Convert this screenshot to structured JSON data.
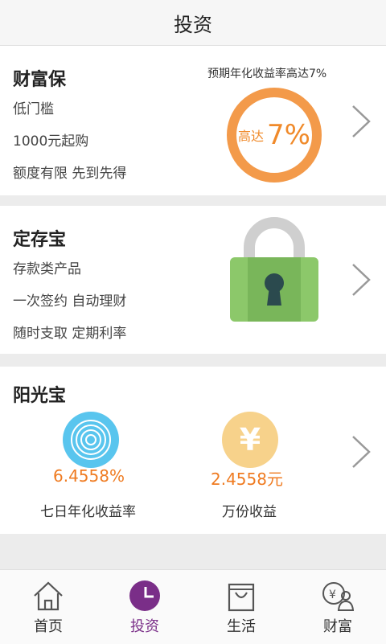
{
  "header": {
    "title": "投资"
  },
  "card1": {
    "name": "财富保",
    "lines": [
      "低门槛",
      "1000元起购",
      "额度有限 先到先得"
    ],
    "expected": "预期年化收益率高达7%",
    "ring_prefix": "高达",
    "ring_value": "7%"
  },
  "card2": {
    "name": "定存宝",
    "lines": [
      "存款类产品",
      "一次签约 自动理财",
      "随时支取 定期利率"
    ]
  },
  "card3": {
    "name": "阳光宝",
    "rate_value": "6.4558%",
    "rate_label": "七日年化收益率",
    "earn_value": "2.4558元",
    "earn_label": "万份收益",
    "yen_symbol": "¥"
  },
  "tabs": [
    {
      "label": "首页",
      "icon": "home-icon"
    },
    {
      "label": "投资",
      "icon": "pie-chart-icon",
      "active": true
    },
    {
      "label": "生活",
      "icon": "shopping-bag-icon"
    },
    {
      "label": "财富",
      "icon": "wealth-user-icon"
    }
  ],
  "colors": {
    "accent_purple": "#7a2e88",
    "orange": "#f08a2a",
    "ring": "#f39a4a",
    "blue": "#59c5ee",
    "gold": "#f7d28b",
    "lock_green": "#8cc86a",
    "lock_dark": "#2b4a4e"
  }
}
